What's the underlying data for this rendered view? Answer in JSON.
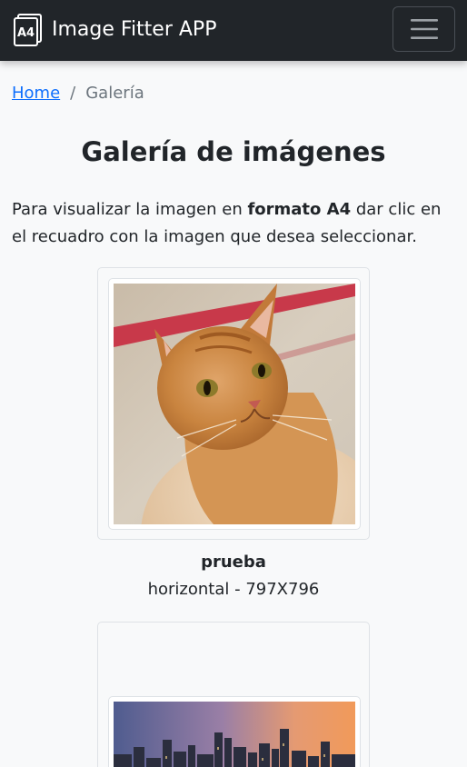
{
  "navbar": {
    "brand_icon_text": "A4",
    "brand_title": "Image Fitter APP"
  },
  "breadcrumb": {
    "home": "Home",
    "separator": "/",
    "current": "Galería"
  },
  "page": {
    "title": "Galería de imágenes",
    "intro_before": "Para visualizar la imagen en ",
    "intro_bold": "formato A4",
    "intro_after": " dar clic en el recuadro con la imagen que desea seleccionar."
  },
  "gallery": [
    {
      "name": "prueba",
      "meta": "horizontal - 797X796",
      "image_subject": "orange tabby cat"
    },
    {
      "image_subject": "city skyline at sunset"
    }
  ],
  "colors": {
    "navbar_bg": "#212529",
    "link": "#0d6efd",
    "page_bg": "#f8f9fa"
  }
}
